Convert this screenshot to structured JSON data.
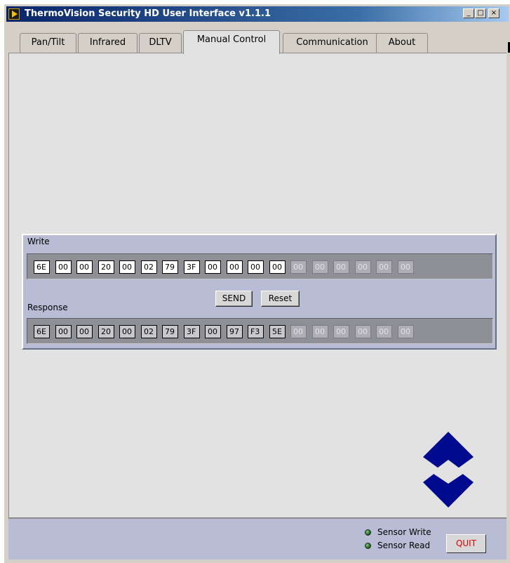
{
  "window": {
    "title": "ThermoVision Security HD User Interface v1.1.1",
    "controls": {
      "minimize": "_",
      "maximize": "□",
      "close": "×"
    }
  },
  "tabs": [
    {
      "label": "Pan/Tilt",
      "active": false
    },
    {
      "label": "Infrared",
      "active": false
    },
    {
      "label": "DLTV",
      "active": false
    },
    {
      "label": "Manual Control",
      "active": true
    },
    {
      "label": "Communication",
      "active": false
    },
    {
      "label": "About",
      "active": false
    }
  ],
  "manual": {
    "write_label": "Write",
    "response_label": "Response",
    "write_bytes": [
      "6E",
      "00",
      "00",
      "20",
      "00",
      "02",
      "79",
      "3F",
      "00",
      "00",
      "00",
      "00",
      "00",
      "00",
      "00",
      "00",
      "00",
      "00"
    ],
    "write_enabled_count": 12,
    "response_bytes": [
      "6E",
      "00",
      "00",
      "20",
      "00",
      "02",
      "79",
      "3F",
      "00",
      "97",
      "F3",
      "5E",
      "00",
      "00",
      "00",
      "00",
      "00",
      "00"
    ],
    "response_enabled_count": 12,
    "send_label": "SEND",
    "reset_label": "Reset"
  },
  "status": {
    "sensor_write_label": "Sensor Write",
    "sensor_read_label": "Sensor Read",
    "quit_label": "QUIT"
  },
  "colors": {
    "logo": "#000a8f",
    "quit_text": "#e00000",
    "led": "#2e8b2e"
  },
  "icons": [
    "app-icon",
    "minimize-icon",
    "maximize-icon",
    "close-icon",
    "logo-diamonds-icon",
    "led-icon"
  ]
}
